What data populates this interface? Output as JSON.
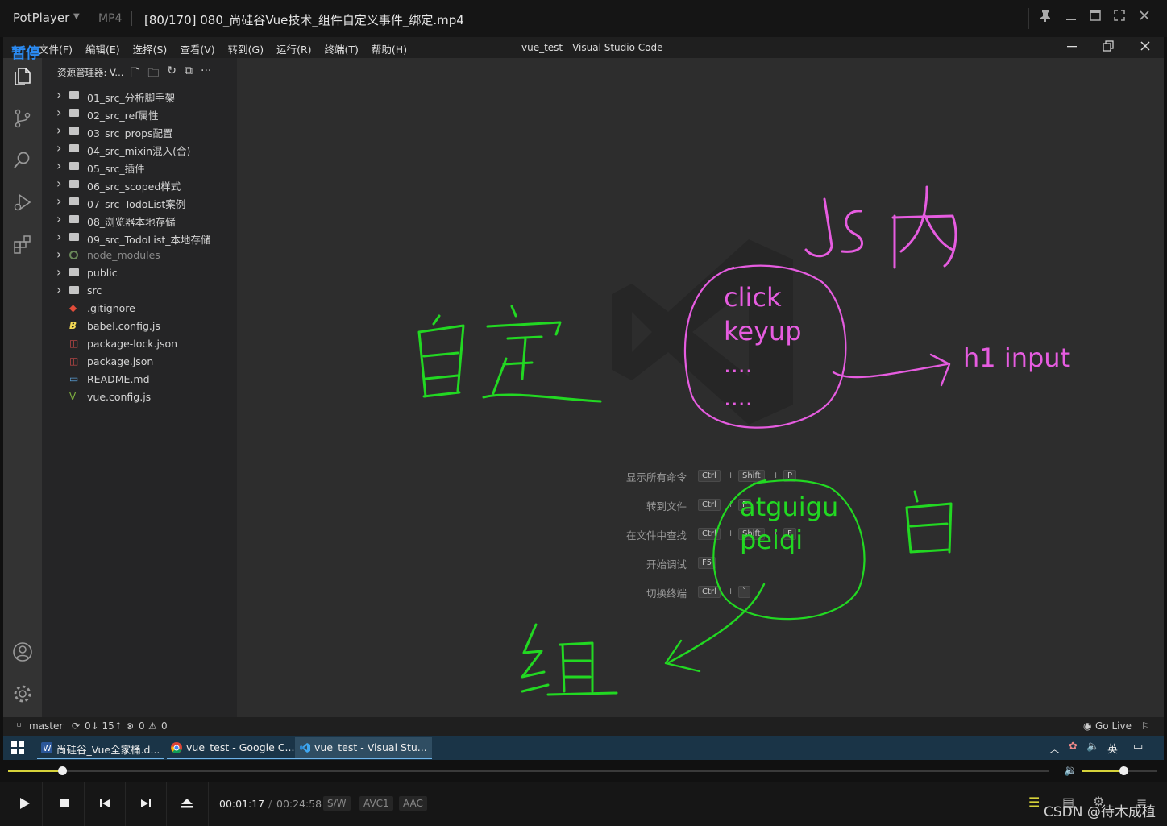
{
  "player": {
    "brand": "PotPlayer",
    "format": "MP4",
    "file_title": "[80/170] 080_尚硅谷Vue技术_组件自定义事件_绑定.mp4",
    "pause_label": "暂停"
  },
  "vscode": {
    "menu": [
      "文件(F)",
      "编辑(E)",
      "选择(S)",
      "查看(V)",
      "转到(G)",
      "运行(R)",
      "终端(T)",
      "帮助(H)"
    ],
    "window_title": "vue_test - Visual Studio Code",
    "explorer_title": "资源管理器: V...",
    "tree": [
      {
        "label": "01_src_分析脚手架",
        "kind": "folder"
      },
      {
        "label": "02_src_ref属性",
        "kind": "folder"
      },
      {
        "label": "03_src_props配置",
        "kind": "folder"
      },
      {
        "label": "04_src_mixin混入(合)",
        "kind": "folder"
      },
      {
        "label": "05_src_插件",
        "kind": "folder"
      },
      {
        "label": "06_src_scoped样式",
        "kind": "folder"
      },
      {
        "label": "07_src_TodoList案例",
        "kind": "folder"
      },
      {
        "label": "08_浏览器本地存储",
        "kind": "folder"
      },
      {
        "label": "09_src_TodoList_本地存储",
        "kind": "folder"
      },
      {
        "label": "node_modules",
        "kind": "node_modules"
      },
      {
        "label": "public",
        "kind": "folder"
      },
      {
        "label": "src",
        "kind": "folder"
      },
      {
        "label": ".gitignore",
        "kind": "git"
      },
      {
        "label": "babel.config.js",
        "kind": "babel"
      },
      {
        "label": "package-lock.json",
        "kind": "json"
      },
      {
        "label": "package.json",
        "kind": "json"
      },
      {
        "label": "README.md",
        "kind": "md"
      },
      {
        "label": "vue.config.js",
        "kind": "vue"
      }
    ],
    "shortcuts": [
      {
        "label": "显示所有命令",
        "keys": [
          "Ctrl",
          "Shift",
          "P"
        ]
      },
      {
        "label": "转到文件",
        "keys": [
          "Ctrl",
          "P"
        ]
      },
      {
        "label": "在文件中查找",
        "keys": [
          "Ctrl",
          "Shift",
          "F"
        ]
      },
      {
        "label": "开始调试",
        "keys": [
          "F5"
        ]
      },
      {
        "label": "切换终端",
        "keys": [
          "Ctrl",
          "`"
        ]
      }
    ],
    "status": {
      "branch": "master",
      "sync": "0↓ 15↑",
      "errors": "0",
      "warnings": "0",
      "golive": "Go Live"
    }
  },
  "annotations": {
    "events_1": "click",
    "events_2": "keyup",
    "events_3": "....",
    "events_4": "....",
    "targets": "h1  input",
    "names_1": "atguigu",
    "names_2": "peiqi",
    "hw_js": "Js 内",
    "hw_custom": "自定",
    "hw_self": "自",
    "hw_comp": "组"
  },
  "taskbar": {
    "items": [
      "尚硅谷_Vue全家桶.d...",
      "vue_test - Google C...",
      "vue_test - Visual Stu..."
    ],
    "ime": "英"
  },
  "playback": {
    "current_time": "00:01:17",
    "total_time": "00:24:58",
    "tags": [
      "S/W",
      "AVC1",
      "AAC"
    ],
    "progress_fraction": 0.052,
    "volume_fraction": 0.55
  },
  "watermark": "CSDN @待木成植",
  "colors": {
    "ink_pink": "#e65ce0",
    "ink_green": "#22d822",
    "accent_blue": "#2b8cf5"
  }
}
